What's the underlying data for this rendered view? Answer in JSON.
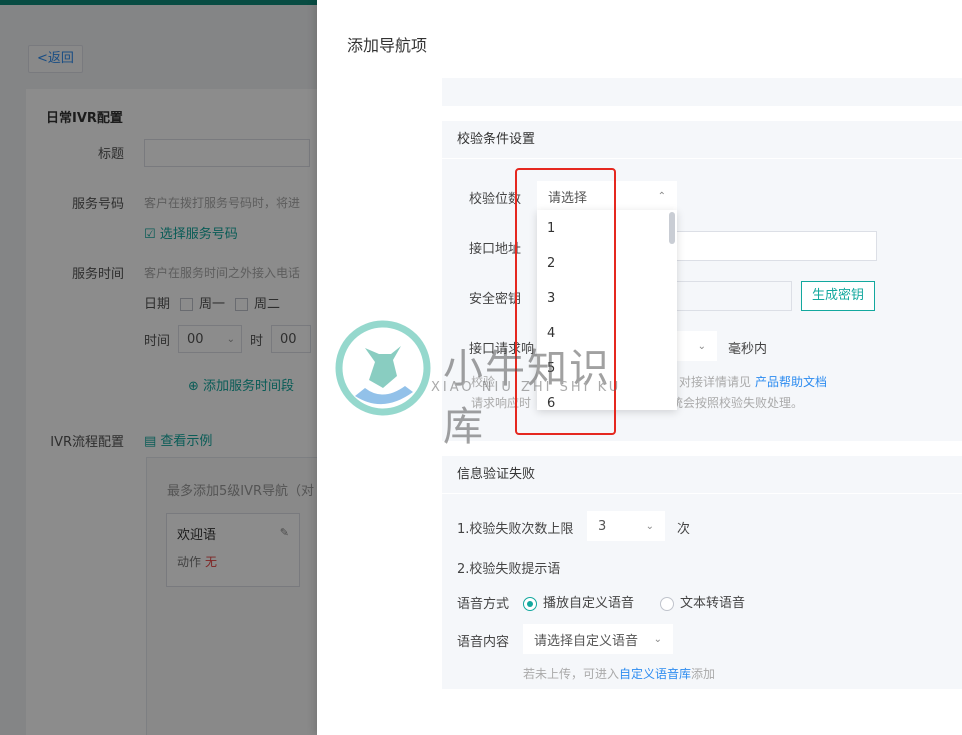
{
  "background": {
    "back_label": "<返回",
    "section_title": "日常IVR配置",
    "labels": {
      "title": "标题",
      "service_number": "服务号码",
      "service_time": "服务时间",
      "ivr_flow": "IVR流程配置"
    },
    "service_number_hint": "客户在拨打服务号码时，将进",
    "select_number_link": "选择服务号码",
    "service_time_hint": "客户在服务时间之外接入电话",
    "date_label": "日期",
    "weekdays": [
      "周一",
      "周二"
    ],
    "time_label": "时间",
    "hour_value": "00",
    "hour_unit": "时",
    "minute_value": "00",
    "add_time_link": "添加服务时间段",
    "view_example_link": "查看示例",
    "ivr_hint": "最多添加5级IVR导航（对",
    "welcome_card": {
      "title": "欢迎语",
      "action_label": "动作",
      "action_value": "无"
    }
  },
  "drawer": {
    "title": "添加导航项",
    "verify_section": {
      "header": "校验条件设置",
      "digits_label": "校验位数",
      "digits_placeholder": "请选择",
      "api_label": "接口地址",
      "secret_label": "安全密钥",
      "generate_button": "生成密钥",
      "timeout_label": "接口请求响",
      "timeout_unit": "毫秒内",
      "note_line1_start": "校验",
      "note_line1_end": "充，对接详情请见",
      "help_link": "产品帮助文档",
      "note_line2_start": "请求响应时",
      "note_line2_end": "统会按照校验失败处理。"
    },
    "fail_section": {
      "header": "信息验证失败",
      "limit_label": "1.校验失败次数上限",
      "limit_value": "3",
      "limit_unit": "次",
      "prompt_label": "2.校验失败提示语",
      "voice_mode_label": "语音方式",
      "voice_option_custom": "播放自定义语音",
      "voice_option_tts": "文本转语音",
      "voice_content_label": "语音内容",
      "voice_content_placeholder": "请选择自定义语音",
      "upload_hint_start": "若未上传，可进入",
      "upload_link": "自定义语音库",
      "upload_hint_end": "添加"
    },
    "dropdown_options": [
      "1",
      "2",
      "3",
      "4",
      "5",
      "6"
    ]
  },
  "watermark": {
    "text": "小牛知识库",
    "sub": "XIAO NIU ZHI SHI KU"
  },
  "colors": {
    "accent": "#13a89e",
    "link_blue": "#2d8cf0",
    "highlight": "#e5281f",
    "header_green": "#0f8a7a"
  }
}
